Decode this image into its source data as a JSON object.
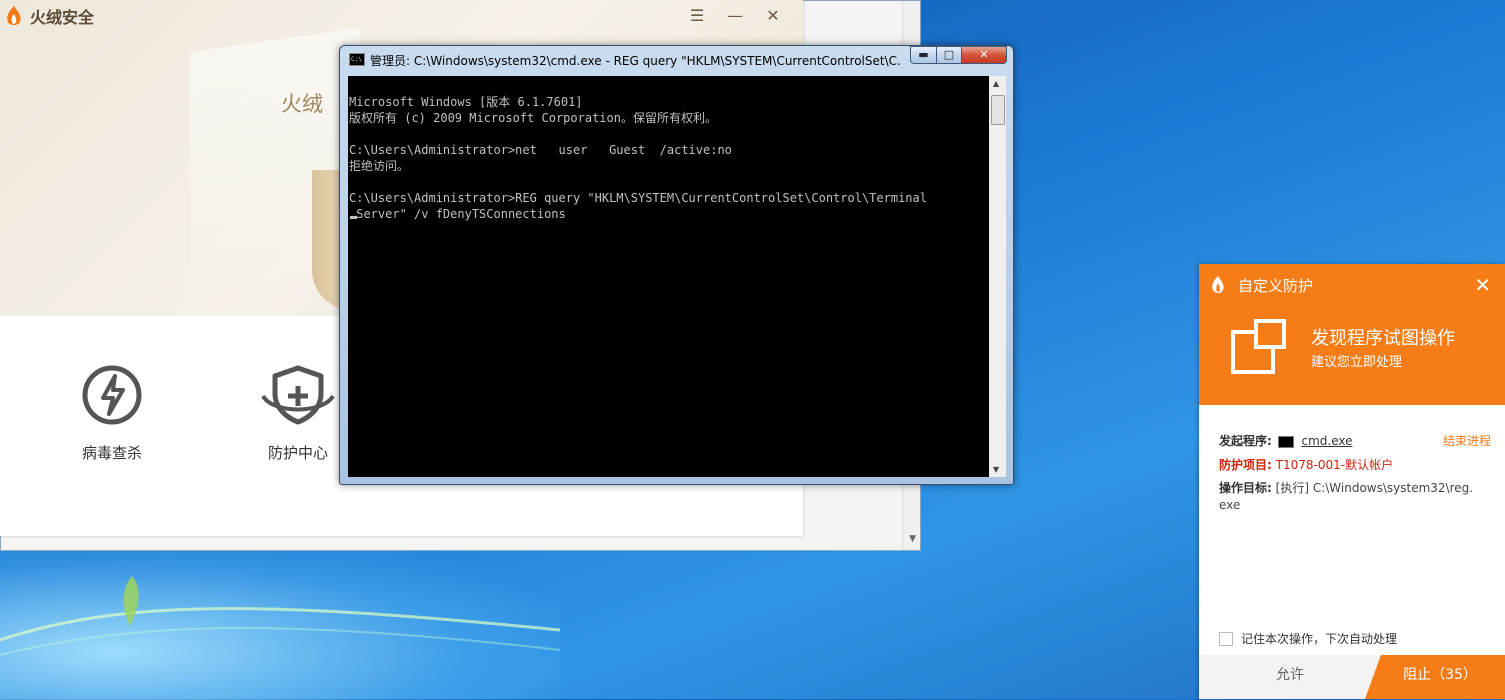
{
  "desktop": {
    "wallpaper": "windows-7-blue"
  },
  "huorong": {
    "app_name": "火绒安全",
    "header_text": "火绒",
    "controls": {
      "menu": "☰",
      "minimize": "—",
      "close": "✕"
    },
    "tools": [
      {
        "label": "病毒查杀",
        "icon": "lightning-circle-icon"
      },
      {
        "label": "防护中心",
        "icon": "shield-plus-icon"
      }
    ],
    "accent_color": "#a0855c"
  },
  "cmd": {
    "title": "管理员: C:\\Windows\\system32\\cmd.exe - REG  query \"HKLM\\SYSTEM\\CurrentControlSet\\C...",
    "icon_text": "C:\\",
    "buttons": {
      "minimize": "▬",
      "maximize": "□",
      "close": "✕"
    },
    "lines": [
      "Microsoft Windows [版本 6.1.7601]",
      "版权所有 (c) 2009 Microsoft Corporation。保留所有权利。",
      "",
      "C:\\Users\\Administrator>net   user   Guest  /active:no",
      "拒绝访问。",
      "",
      "C:\\Users\\Administrator>REG query \"HKLM\\SYSTEM\\CurrentControlSet\\Control\\Terminal",
      " Server\" /v fDenyTSConnections"
    ]
  },
  "popup": {
    "title": "自定义防护",
    "close": "✕",
    "headline": "发现程序试图操作",
    "subline": "建议您立即处理",
    "initiator_label": "发起程序:",
    "initiator_value": "cmd.exe",
    "end_process": "结束进程",
    "protect_label": "防护项目:",
    "protect_value": "T1078-001-默认帐户",
    "target_label": "操作目标:",
    "target_value_line1": "[执行] C:\\Windows\\system32\\reg.",
    "target_value_line2": "exe",
    "remember_label": "记住本次操作，下次自动处理",
    "allow_label": "允许",
    "block_label": "阻止（35）",
    "accent_color": "#f57c17",
    "alert_color": "#d2220a"
  }
}
